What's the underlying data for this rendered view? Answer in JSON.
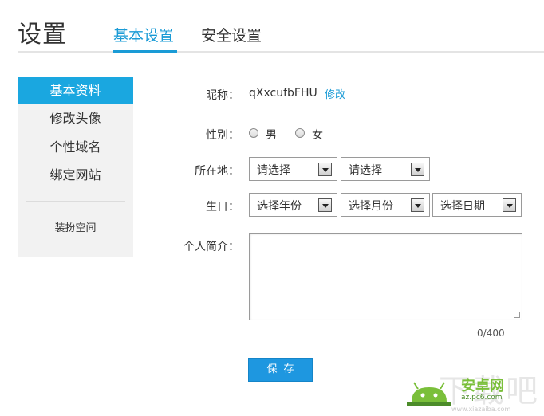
{
  "header": {
    "title": "设置",
    "tabs": [
      {
        "label": "基本设置",
        "active": true
      },
      {
        "label": "安全设置",
        "active": false
      }
    ]
  },
  "sidebar": {
    "items": [
      {
        "label": "基本资料",
        "active": true
      },
      {
        "label": "修改头像",
        "active": false
      },
      {
        "label": "个性域名",
        "active": false
      },
      {
        "label": "绑定网站",
        "active": false
      }
    ],
    "extra": "装扮空间"
  },
  "form": {
    "nickname": {
      "label": "昵称：",
      "value": "qXxcufbFHU",
      "edit_link": "修改"
    },
    "gender": {
      "label": "性别：",
      "options": [
        "男",
        "女"
      ]
    },
    "location": {
      "label": "所在地：",
      "province": "请选择",
      "city": "请选择"
    },
    "birthday": {
      "label": "生日：",
      "year": "选择年份",
      "month": "选择月份",
      "day": "选择日期"
    },
    "bio": {
      "label": "个人简介：",
      "value": "",
      "counter": "0/400"
    },
    "save_label": "保存"
  },
  "watermark": {
    "big_text": "下载吧",
    "brand": "安卓网",
    "url": "az.pc6.com",
    "url2": "www.xiazaiba.com"
  },
  "colors": {
    "accent": "#1a9bd6",
    "sidebar_active": "#1aa7e0",
    "button": "#1e97e0",
    "sidebar_bg": "#f2f2f2"
  }
}
